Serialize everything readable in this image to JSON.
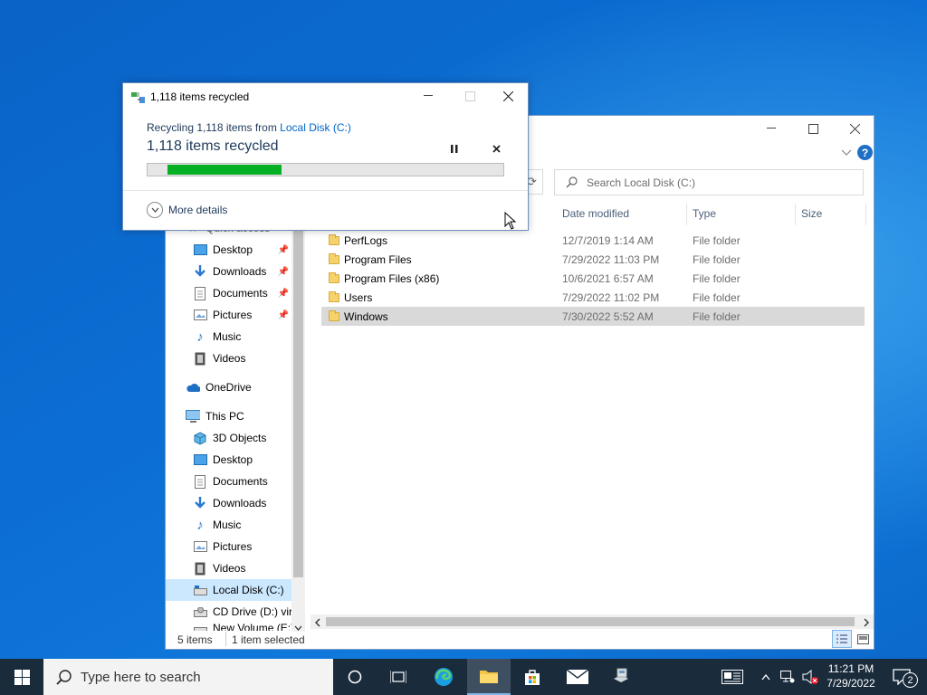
{
  "explorer": {
    "search_placeholder": "Search Local Disk (C:)",
    "columns": {
      "date": "Date modified",
      "type": "Type",
      "size": "Size"
    },
    "nav": {
      "quick_access": "Quick access",
      "desktop": "Desktop",
      "downloads": "Downloads",
      "documents": "Documents",
      "pictures": "Pictures",
      "music": "Music",
      "videos": "Videos",
      "onedrive": "OneDrive",
      "this_pc": "This PC",
      "objects3d": "3D Objects",
      "desktop2": "Desktop",
      "documents2": "Documents",
      "downloads2": "Downloads",
      "music2": "Music",
      "pictures2": "Pictures",
      "videos2": "Videos",
      "local_disk": "Local Disk (C:)",
      "cd_drive": "CD Drive (D:) virt",
      "new_volume": "New Volume (E:)"
    },
    "files": [
      {
        "name": "PerfLogs",
        "date": "12/7/2019 1:14 AM",
        "type": "File folder"
      },
      {
        "name": "Program Files",
        "date": "7/29/2022 11:03 PM",
        "type": "File folder"
      },
      {
        "name": "Program Files (x86)",
        "date": "10/6/2021 6:57 AM",
        "type": "File folder"
      },
      {
        "name": "Users",
        "date": "7/29/2022 11:02 PM",
        "type": "File folder"
      },
      {
        "name": "Windows",
        "date": "7/30/2022 5:52 AM",
        "type": "File folder"
      }
    ],
    "status": {
      "items": "5 items",
      "selected": "1 item selected"
    }
  },
  "dialog": {
    "title": "1,118 items recycled",
    "line1_prefix": "Recycling 1,118 items from ",
    "line1_link": "Local Disk (C:)",
    "headline": "1,118 items recycled",
    "progress_fraction": 0.32,
    "more_details": "More details"
  },
  "taskbar": {
    "search_placeholder": "Type here to search",
    "time": "11:21 PM",
    "date": "7/29/2022",
    "notification_count": "2"
  }
}
